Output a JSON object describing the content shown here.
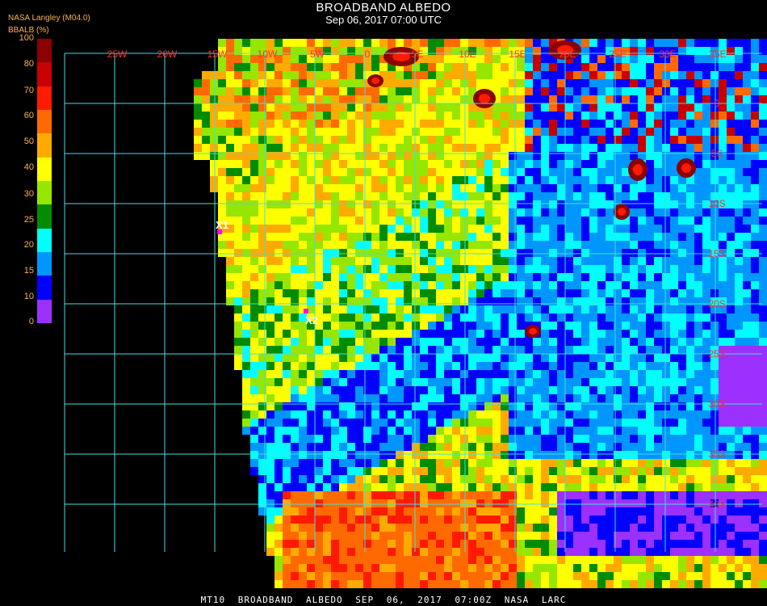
{
  "header": {
    "producer": "NASA Langley (M04.0)",
    "title": "BROADBAND ALBEDO",
    "subtitle": "Sep 06, 2017 07:00 UTC"
  },
  "legend": {
    "unit_label": "BBALB (%)",
    "ticks": [
      "100",
      "80",
      "70",
      "60",
      "50",
      "40",
      "30",
      "25",
      "20",
      "15",
      "10",
      "0"
    ],
    "colors": [
      "#8b0000",
      "#c80000",
      "#ff1a00",
      "#ff6a00",
      "#ffaa00",
      "#ffff00",
      "#96e600",
      "#008c00",
      "#00ffff",
      "#0096ff",
      "#0000ff",
      "#9b30ff"
    ]
  },
  "map": {
    "lon_labels": [
      "25W",
      "20W",
      "15W",
      "10W",
      "5W",
      "0",
      "5E",
      "10E",
      "15E",
      "20E",
      "25E",
      "30E",
      "35E"
    ],
    "lat_labels": [
      "0",
      "5S",
      "10S",
      "15S",
      "20S",
      "25S",
      "30S",
      "35S",
      "40S"
    ],
    "markers": [
      {
        "label": "X1",
        "color": "#ff00ff"
      },
      {
        "label": "X2",
        "color": "#ff00ff"
      }
    ],
    "grid_color": "#40e0e0",
    "label_color": "#ff3030"
  },
  "footer": {
    "text": "MT10 BROADBAND ALBEDO SEP 06, 2017 07:00Z NASA LARC"
  }
}
